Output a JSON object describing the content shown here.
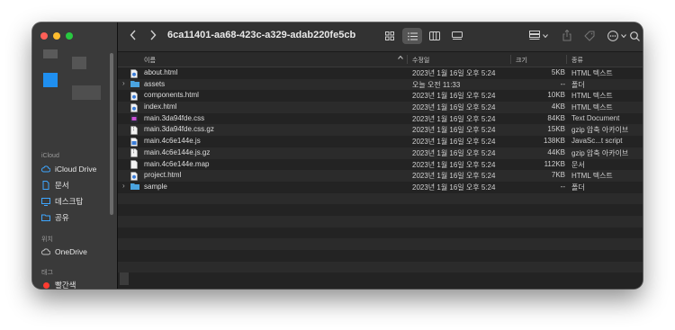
{
  "toolbar": {
    "title": "6ca11401-aa68-423c-a329-adab220fe5cb",
    "back": "‹",
    "forward": "›"
  },
  "sidebar": {
    "icloud_section": "iCloud",
    "icloud_items": [
      {
        "label": "iCloud Drive",
        "icon": "cloud-icon"
      },
      {
        "label": "문서",
        "icon": "document-icon"
      },
      {
        "label": "데스크탑",
        "icon": "desktop-icon"
      },
      {
        "label": "공유",
        "icon": "shared-folder-icon"
      }
    ],
    "locations_section": "위치",
    "location_items": [
      {
        "label": "OneDrive",
        "icon": "cloud-icon"
      }
    ],
    "tags_section": "태그",
    "tag_items": [
      {
        "label": "빨간색",
        "color": "#ff3b30"
      }
    ]
  },
  "columns": {
    "name": "이름",
    "modified": "수정일",
    "size": "크기",
    "kind": "종류"
  },
  "files": [
    {
      "name": "about.html",
      "date": "2023년 1월 16일 오후 5:24",
      "size": "5KB",
      "kind": "HTML 텍스트",
      "icon": "html-file-icon",
      "folder": false
    },
    {
      "name": "assets",
      "date": "오늘 오전 11:33",
      "size": "--",
      "kind": "폴더",
      "icon": "folder-icon",
      "folder": true
    },
    {
      "name": "components.html",
      "date": "2023년 1월 16일 오후 5:24",
      "size": "10KB",
      "kind": "HTML 텍스트",
      "icon": "html-file-icon",
      "folder": false
    },
    {
      "name": "index.html",
      "date": "2023년 1월 16일 오후 5:24",
      "size": "4KB",
      "kind": "HTML 텍스트",
      "icon": "html-file-icon",
      "folder": false
    },
    {
      "name": "main.3da94fde.css",
      "date": "2023년 1월 16일 오후 5:24",
      "size": "84KB",
      "kind": "Text Document",
      "icon": "css-file-icon",
      "folder": false
    },
    {
      "name": "main.3da94fde.css.gz",
      "date": "2023년 1월 16일 오후 5:24",
      "size": "15KB",
      "kind": "gzip 압축 아카이브",
      "icon": "archive-file-icon",
      "folder": false
    },
    {
      "name": "main.4c6e144e.js",
      "date": "2023년 1월 16일 오후 5:24",
      "size": "138KB",
      "kind": "JavaSc...t script",
      "icon": "js-file-icon",
      "folder": false
    },
    {
      "name": "main.4c6e144e.js.gz",
      "date": "2023년 1월 16일 오후 5:24",
      "size": "44KB",
      "kind": "gzip 압축 아카이브",
      "icon": "archive-file-icon",
      "folder": false
    },
    {
      "name": "main.4c6e144e.map",
      "date": "2023년 1월 16일 오후 5:24",
      "size": "112KB",
      "kind": "문서",
      "icon": "document-file-icon",
      "folder": false
    },
    {
      "name": "project.html",
      "date": "2023년 1월 16일 오후 5:24",
      "size": "7KB",
      "kind": "HTML 텍스트",
      "icon": "html-file-icon",
      "folder": false
    },
    {
      "name": "sample",
      "date": "2023년 1월 16일 오후 5:24",
      "size": "--",
      "kind": "폴더",
      "icon": "folder-icon",
      "folder": true
    }
  ],
  "colors": {
    "folder": "#4aa3df",
    "accent": "#2f80ed"
  }
}
